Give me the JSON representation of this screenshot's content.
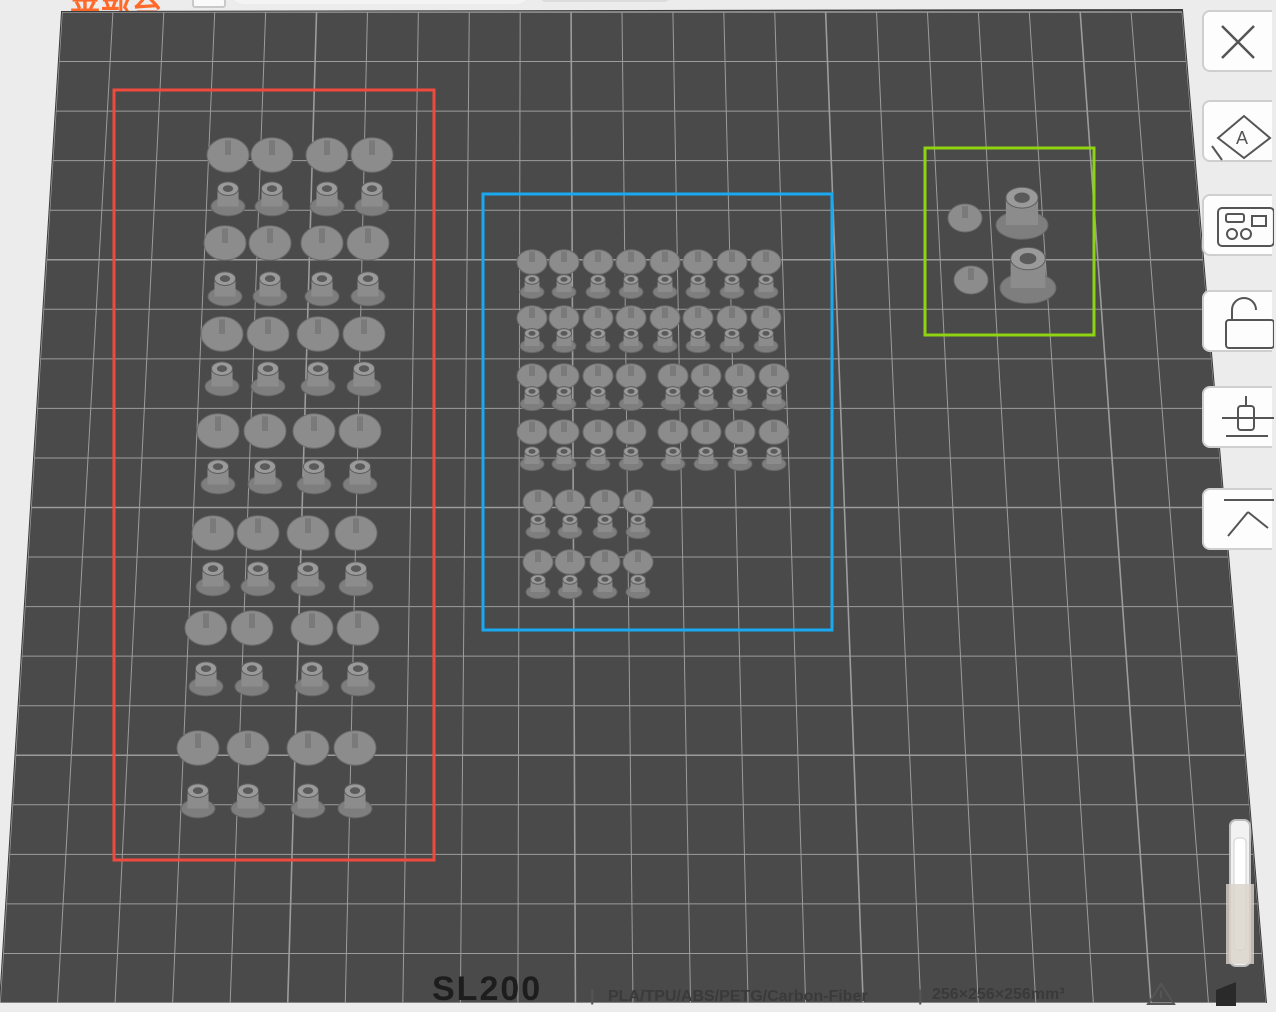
{
  "plate": {
    "title": "来部台",
    "model_name": "SL200",
    "filaments": "PLA/TPU/ABS/PETG/Carbon-Fiber",
    "build_volume": "256×256×256mm³"
  },
  "groups": [
    {
      "name": "red-group",
      "color": "#f04a3e"
    },
    {
      "name": "blue-group",
      "color": "#19a8f2"
    },
    {
      "name": "green-group",
      "color": "#8fd311"
    }
  ],
  "toolbar": {
    "items": [
      {
        "name": "close-icon"
      },
      {
        "name": "auto-orient-icon"
      },
      {
        "name": "arrange-icon"
      },
      {
        "name": "lock-icon"
      },
      {
        "name": "split-icon"
      },
      {
        "name": "layer-icon"
      }
    ]
  },
  "colors": {
    "plate": "#4a4a4a",
    "grid": "#9c9c9c",
    "part": "#8c8c8c",
    "background": "#ececec"
  }
}
